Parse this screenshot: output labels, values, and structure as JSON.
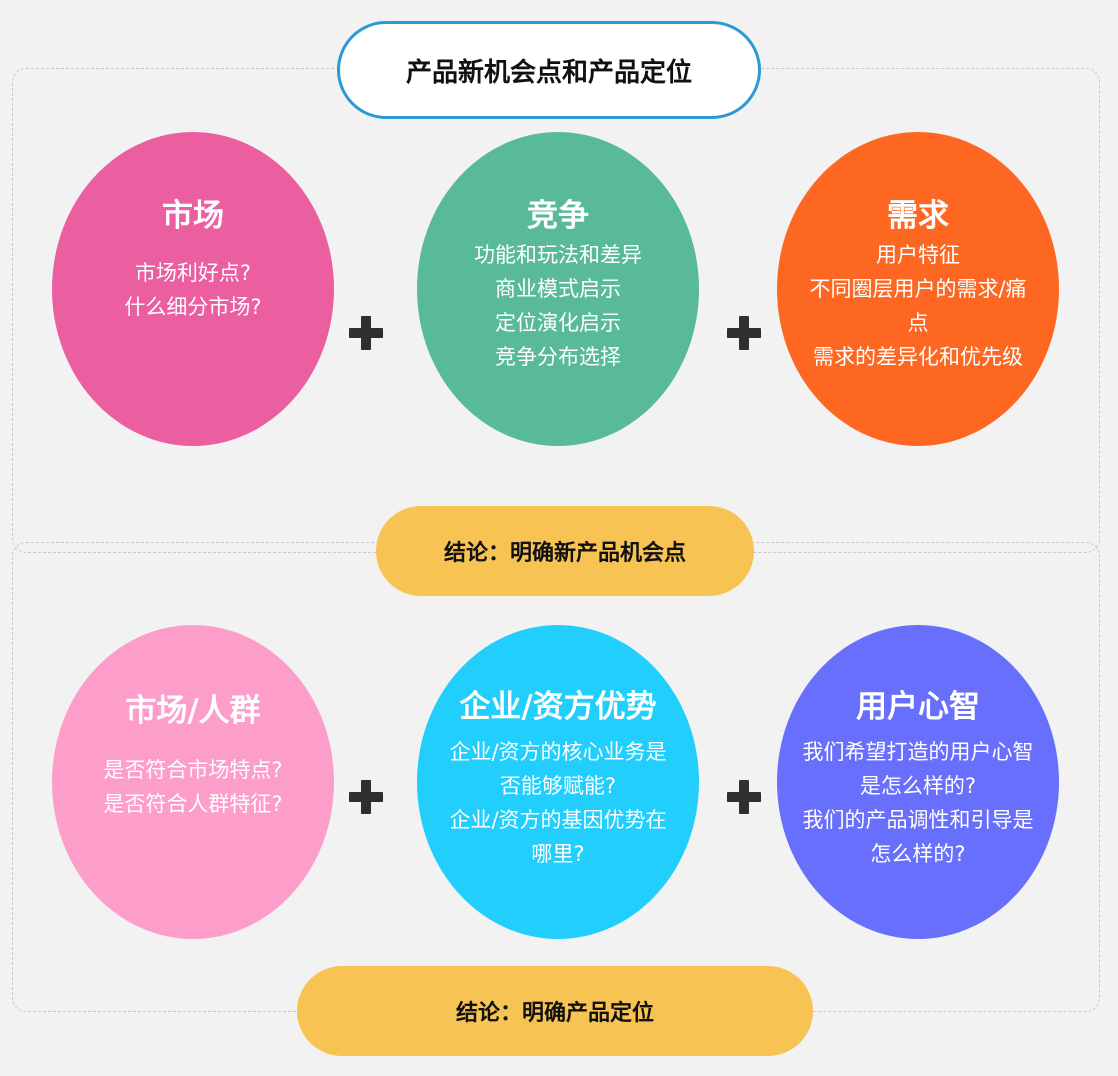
{
  "title": "产品新机会点和产品定位",
  "section1": {
    "circles": [
      {
        "heading": "市场",
        "lines": [
          "市场利好点?",
          "什么细分市场?"
        ],
        "color": "#eb5ea0"
      },
      {
        "heading": "竞争",
        "lines": [
          "功能和玩法和差异",
          "商业模式启示",
          "定位演化启示",
          "竞争分布选择"
        ],
        "color": "#59ba98"
      },
      {
        "heading": "需求",
        "lines": [
          "用户特征",
          "不同圈层用户的需求/痛",
          "点",
          "需求的差异化和优先级"
        ],
        "color": "#fd6722"
      }
    ],
    "conclusion": "结论：明确新产品机会点"
  },
  "section2": {
    "circles": [
      {
        "heading": "市场/人群",
        "lines": [
          "是否符合市场特点?",
          "是否符合人群特征?"
        ],
        "color": "#fd9dca"
      },
      {
        "heading": "企业/资方优势",
        "lines": [
          "企业/资方的核心业务是",
          "否能够赋能?",
          "企业/资方的基因优势在",
          "哪里?"
        ],
        "color": "#22cefc"
      },
      {
        "heading": "用户心智",
        "lines": [
          "我们希望打造的用户心智",
          "是怎么样的?",
          "我们的产品调性和引导是",
          "怎么样的?"
        ],
        "color": "#676ffc"
      }
    ],
    "conclusion": "结论：明确产品定位"
  },
  "colors": {
    "title_border": "#2b9ad4",
    "conclusion_fill": "#f7c352",
    "plus": "#2f2f2f"
  }
}
